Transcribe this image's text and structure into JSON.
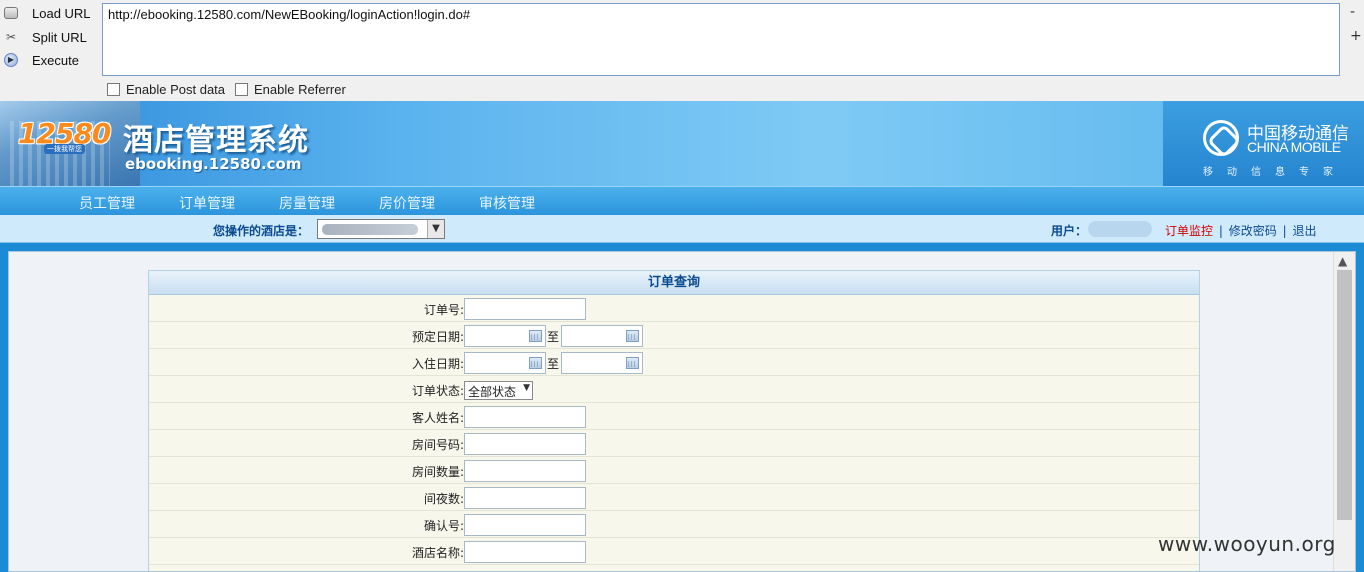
{
  "hackbar": {
    "load_label": "Load URL",
    "split_label": "Split URL",
    "execute_label": "Execute",
    "url": "http://ebooking.12580.com/NewEBooking/loginAction!login.do#",
    "enable_post": "Enable Post data",
    "enable_referrer": "Enable Referrer",
    "minus": "-",
    "plus": "+"
  },
  "banner": {
    "logo_number": "12580",
    "logo_slogan": "一拨我帮您",
    "system_title": "酒店管理系统",
    "domain": "ebooking.12580.com",
    "brand_cn": "中国移动通信",
    "brand_en": "CHINA MOBILE",
    "brand_sub": "移动信息专家"
  },
  "nav": {
    "items": [
      "员工管理",
      "订单管理",
      "房量管理",
      "房价管理",
      "审核管理"
    ]
  },
  "subbar": {
    "hotel_label": "您操作的酒店是：",
    "user_label": "用户：",
    "order_monitor": "订单监控",
    "change_password": "修改密码",
    "logout": "退出",
    "separator": "|"
  },
  "query": {
    "title": "订单查询",
    "fields": {
      "order_no": "订单号:",
      "book_date": "预定日期:",
      "checkin_date": "入住日期:",
      "order_status": "订单状态:",
      "guest_name": "客人姓名:",
      "room_no": "房间号码:",
      "room_count": "房间数量:",
      "nights": "间夜数:",
      "confirm_no": "确认号:",
      "hotel_name": "酒店名称:"
    },
    "to": "至",
    "status_selected": "全部状态"
  },
  "watermark": "www.wooyun.org",
  "colors": {
    "nav_blue": "#2b95dc",
    "link_red": "#d40000",
    "link_blue": "#0b4b8f",
    "panel_bg": "#f7f7ec"
  }
}
